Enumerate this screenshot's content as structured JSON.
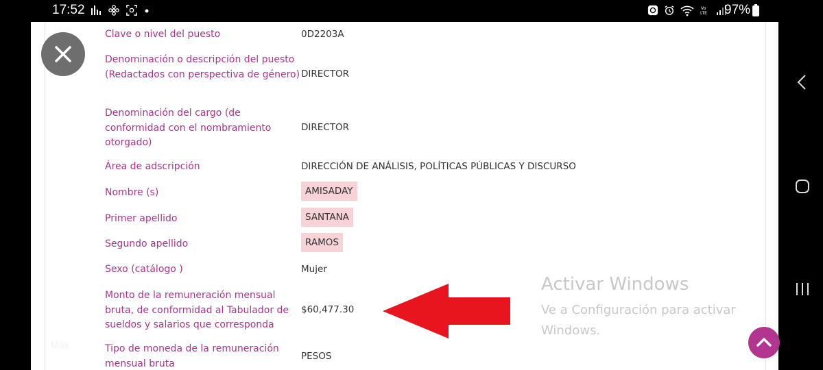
{
  "status_bar": {
    "time": "17:52",
    "battery": "97%"
  },
  "fields": [
    {
      "label": "Clave o nivel del puesto",
      "value": "0D2203A",
      "highlight": false
    },
    {
      "label": "Denominación o descripción del puesto (Redactados con perspectiva de género)",
      "value": "DIRECTOR",
      "highlight": false
    },
    {
      "label": "Denominación del cargo (de conformidad con el nombramiento otorgado)",
      "value": "DIRECTOR",
      "highlight": false
    },
    {
      "label": "Área de adscripción",
      "value": "DIRECCIÓN DE ANÁLISIS, POLÍTICAS PÚBLICAS Y DISCURSO",
      "highlight": false
    },
    {
      "label": "Nombre (s)",
      "value": "AMISADAY",
      "highlight": true
    },
    {
      "label": "Primer apellido",
      "value": "SANTANA",
      "highlight": true
    },
    {
      "label": "Segundo apellido",
      "value": "RAMOS",
      "highlight": true
    },
    {
      "label": "Sexo (catálogo )",
      "value": "Mujer",
      "highlight": false
    },
    {
      "label": "Monto de la remuneración mensual bruta, de conformidad al Tabulador de sueldos y salarios que corresponda",
      "value": "$60,477.30",
      "highlight": false
    },
    {
      "label": "Tipo de moneda de la remuneración mensual bruta",
      "value": "PESOS",
      "highlight": false
    }
  ],
  "watermark": {
    "title": "Activar Windows",
    "subtitle": "Ve a Configuración para activar Windows."
  },
  "more_label": "Más",
  "colors": {
    "label": "#a7358c",
    "highlight": "#f7d3d7",
    "arrow": "#e8141e",
    "scroll_button": "#b2358f"
  }
}
